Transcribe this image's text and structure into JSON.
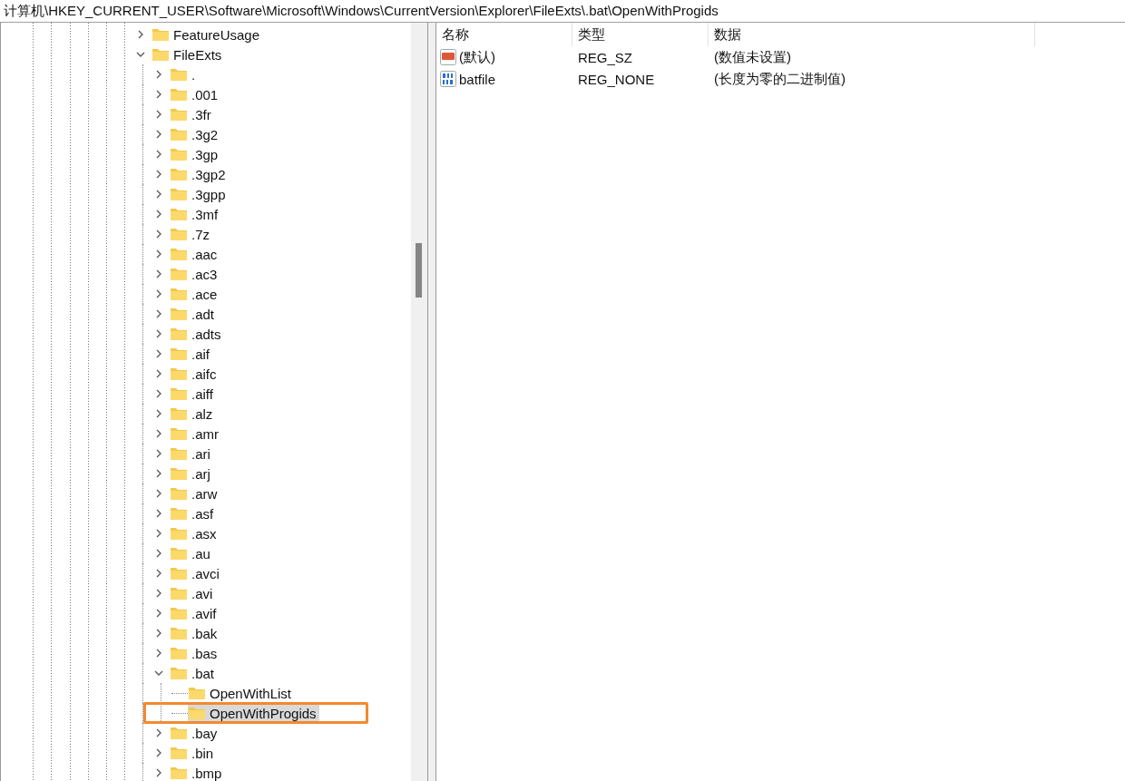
{
  "address_bar": {
    "path": "计算机\\HKEY_CURRENT_USER\\Software\\Microsoft\\Windows\\CurrentVersion\\Explorer\\FileExts\\.bat\\OpenWithProgids"
  },
  "tree": {
    "items": [
      {
        "label": "FeatureUsage",
        "expandable": true,
        "expanded": false,
        "selected": false
      },
      {
        "label": "FileExts",
        "expandable": true,
        "expanded": true,
        "selected": false,
        "children": [
          {
            "label": ".",
            "expandable": true,
            "expanded": false,
            "selected": false
          },
          {
            "label": ".001",
            "expandable": true,
            "expanded": false,
            "selected": false
          },
          {
            "label": ".3fr",
            "expandable": true,
            "expanded": false,
            "selected": false
          },
          {
            "label": ".3g2",
            "expandable": true,
            "expanded": false,
            "selected": false
          },
          {
            "label": ".3gp",
            "expandable": true,
            "expanded": false,
            "selected": false
          },
          {
            "label": ".3gp2",
            "expandable": true,
            "expanded": false,
            "selected": false
          },
          {
            "label": ".3gpp",
            "expandable": true,
            "expanded": false,
            "selected": false
          },
          {
            "label": ".3mf",
            "expandable": true,
            "expanded": false,
            "selected": false
          },
          {
            "label": ".7z",
            "expandable": true,
            "expanded": false,
            "selected": false
          },
          {
            "label": ".aac",
            "expandable": true,
            "expanded": false,
            "selected": false
          },
          {
            "label": ".ac3",
            "expandable": true,
            "expanded": false,
            "selected": false
          },
          {
            "label": ".ace",
            "expandable": true,
            "expanded": false,
            "selected": false
          },
          {
            "label": ".adt",
            "expandable": true,
            "expanded": false,
            "selected": false
          },
          {
            "label": ".adts",
            "expandable": true,
            "expanded": false,
            "selected": false
          },
          {
            "label": ".aif",
            "expandable": true,
            "expanded": false,
            "selected": false
          },
          {
            "label": ".aifc",
            "expandable": true,
            "expanded": false,
            "selected": false
          },
          {
            "label": ".aiff",
            "expandable": true,
            "expanded": false,
            "selected": false
          },
          {
            "label": ".alz",
            "expandable": true,
            "expanded": false,
            "selected": false
          },
          {
            "label": ".amr",
            "expandable": true,
            "expanded": false,
            "selected": false
          },
          {
            "label": ".ari",
            "expandable": true,
            "expanded": false,
            "selected": false
          },
          {
            "label": ".arj",
            "expandable": true,
            "expanded": false,
            "selected": false
          },
          {
            "label": ".arw",
            "expandable": true,
            "expanded": false,
            "selected": false
          },
          {
            "label": ".asf",
            "expandable": true,
            "expanded": false,
            "selected": false
          },
          {
            "label": ".asx",
            "expandable": true,
            "expanded": false,
            "selected": false
          },
          {
            "label": ".au",
            "expandable": true,
            "expanded": false,
            "selected": false
          },
          {
            "label": ".avci",
            "expandable": true,
            "expanded": false,
            "selected": false
          },
          {
            "label": ".avi",
            "expandable": true,
            "expanded": false,
            "selected": false
          },
          {
            "label": ".avif",
            "expandable": true,
            "expanded": false,
            "selected": false
          },
          {
            "label": ".bak",
            "expandable": true,
            "expanded": false,
            "selected": false
          },
          {
            "label": ".bas",
            "expandable": true,
            "expanded": false,
            "selected": false
          },
          {
            "label": ".bat",
            "expandable": true,
            "expanded": true,
            "selected": false,
            "children": [
              {
                "label": "OpenWithList",
                "expandable": false,
                "selected": false
              },
              {
                "label": "OpenWithProgids",
                "expandable": false,
                "selected": true
              }
            ]
          },
          {
            "label": ".bay",
            "expandable": true,
            "expanded": false,
            "selected": false
          },
          {
            "label": ".bin",
            "expandable": true,
            "expanded": false,
            "selected": false
          },
          {
            "label": ".bmp",
            "expandable": true,
            "expanded": false,
            "selected": false
          }
        ]
      }
    ]
  },
  "values": {
    "columns": [
      "名称",
      "类型",
      "数据"
    ],
    "rows": [
      {
        "kind": "string",
        "name": "(默认)",
        "type": "REG_SZ",
        "data": "(数值未设置)"
      },
      {
        "kind": "binary",
        "name": "batfile",
        "type": "REG_NONE",
        "data": "(长度为零的二进制值)"
      }
    ]
  }
}
